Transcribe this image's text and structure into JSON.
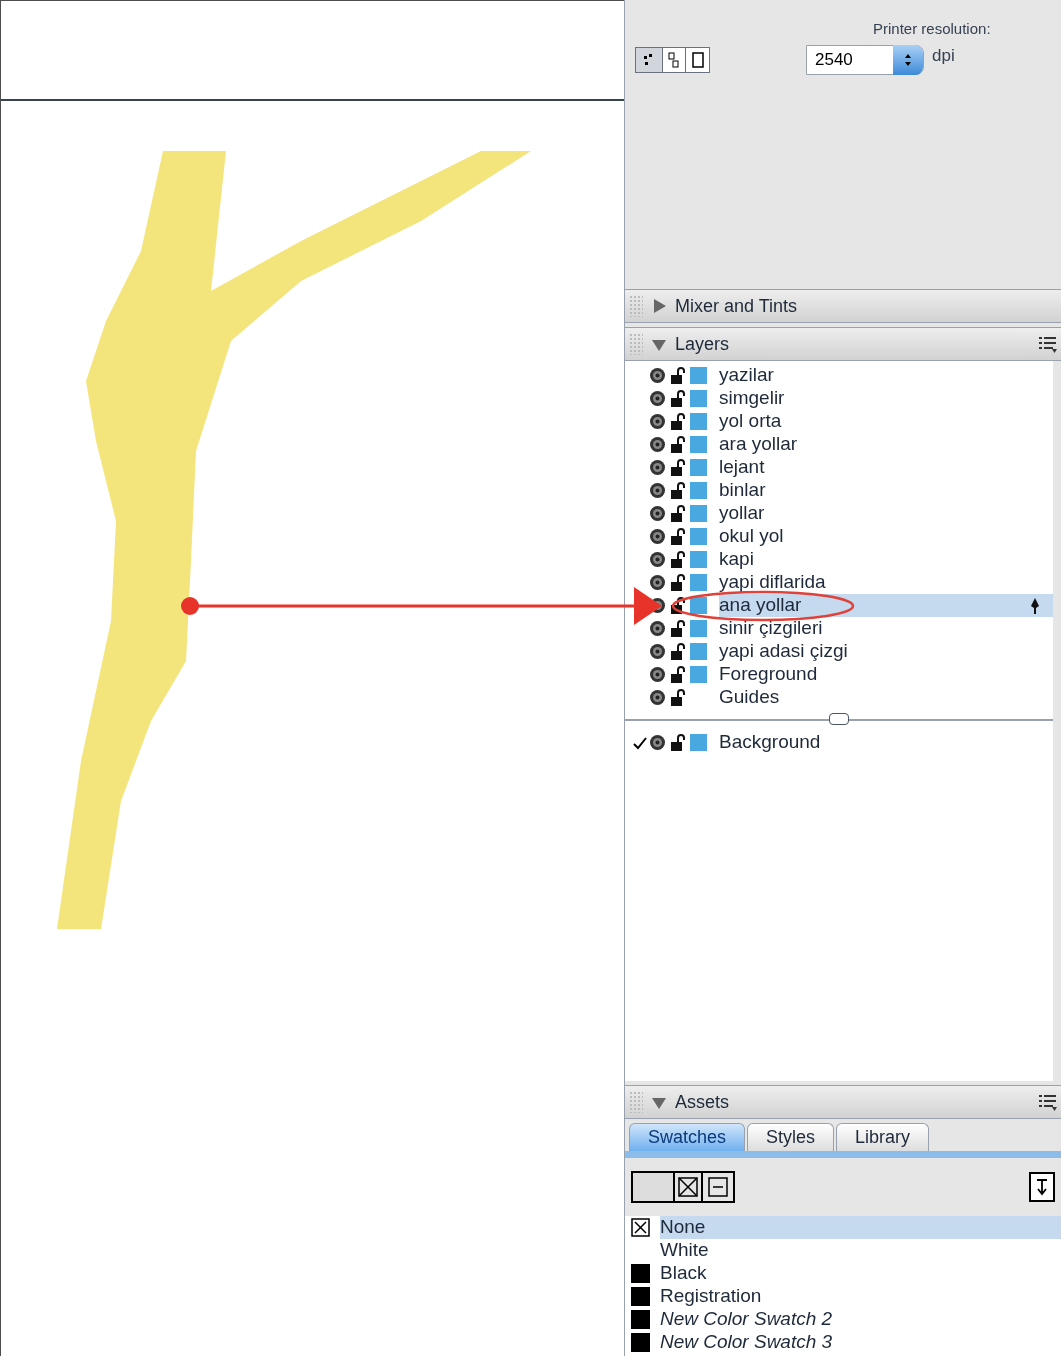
{
  "printer": {
    "label": "Printer resolution:",
    "value": "2540",
    "unit": "dpi"
  },
  "panels": [
    {
      "title": "Mixer and Tints",
      "expanded": false
    },
    {
      "title": "Layers",
      "expanded": true
    }
  ],
  "layers": [
    {
      "name": "yazilar",
      "selected": false,
      "color": "#4aa8e0",
      "active": false
    },
    {
      "name": "simgelir",
      "selected": false,
      "color": "#4aa8e0",
      "active": false
    },
    {
      "name": "yol orta",
      "selected": false,
      "color": "#4aa8e0",
      "active": false
    },
    {
      "name": "ara yollar",
      "selected": false,
      "color": "#4aa8e0",
      "active": false
    },
    {
      "name": "lejant",
      "selected": false,
      "color": "#4aa8e0",
      "active": false
    },
    {
      "name": "binlar",
      "selected": false,
      "color": "#4aa8e0",
      "active": false
    },
    {
      "name": "yollar",
      "selected": false,
      "color": "#4aa8e0",
      "active": false
    },
    {
      "name": "okul yol",
      "selected": false,
      "color": "#4aa8e0",
      "active": false
    },
    {
      "name": "kapi",
      "selected": false,
      "color": "#4aa8e0",
      "active": false
    },
    {
      "name": "yapi diflarida",
      "selected": false,
      "color": "#4aa8e0",
      "active": false
    },
    {
      "name": "ana yollar",
      "selected": true,
      "color": "#4aa8e0",
      "active": false
    },
    {
      "name": "sinir çizgileri",
      "selected": false,
      "color": "#4aa8e0",
      "active": false
    },
    {
      "name": "yapi adasi çizgi",
      "selected": false,
      "color": "#4aa8e0",
      "active": false
    },
    {
      "name": "Foreground",
      "selected": false,
      "color": "#4aa8e0",
      "active": false
    },
    {
      "name": "Guides",
      "selected": false,
      "active": false
    }
  ],
  "background_layer": {
    "name": "Background",
    "selected": false,
    "color": "#4aa8e0",
    "active": true
  },
  "assets": {
    "title": "Assets",
    "expanded": true,
    "tabs": [
      {
        "label": "Swatches",
        "selected": true
      },
      {
        "label": "Styles",
        "selected": false
      },
      {
        "label": "Library",
        "selected": false
      }
    ],
    "swatches": [
      {
        "name": "None",
        "kind": "none",
        "selected": true,
        "italic": false
      },
      {
        "name": "White",
        "kind": "white",
        "selected": false,
        "italic": false
      },
      {
        "name": "Black",
        "kind": "black",
        "selected": false,
        "italic": false
      },
      {
        "name": "Registration",
        "kind": "black",
        "selected": false,
        "italic": false
      },
      {
        "name": "New Color Swatch 2",
        "kind": "black",
        "selected": false,
        "italic": true
      },
      {
        "name": "New Color Swatch 3",
        "kind": "black",
        "selected": false,
        "italic": true
      }
    ]
  }
}
